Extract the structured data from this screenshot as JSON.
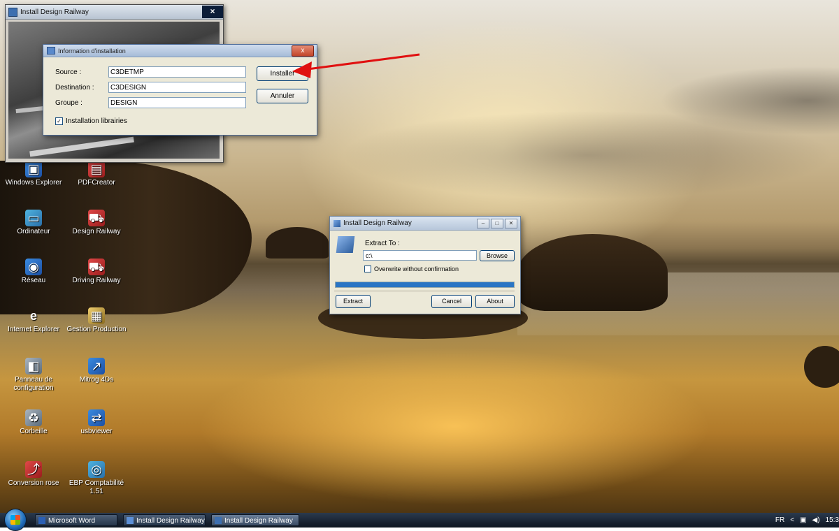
{
  "desktop": {
    "icons": [
      {
        "label": "Windows Explorer",
        "icon": "explorer-icon"
      },
      {
        "label": "PDFCreator",
        "icon": "pdfcreator-icon"
      },
      {
        "label": "Ordinateur",
        "icon": "computer-icon"
      },
      {
        "label": "Design Railway",
        "icon": "design-railway-icon"
      },
      {
        "label": "Réseau",
        "icon": "network-icon"
      },
      {
        "label": "Driving Railway",
        "icon": "driving-railway-icon"
      },
      {
        "label": "Internet Explorer",
        "icon": "internet-explorer-icon"
      },
      {
        "label": "Gestion Production",
        "icon": "gestion-production-icon"
      },
      {
        "label": "Panneau de configuration",
        "icon": "control-panel-icon"
      },
      {
        "label": "Mitrog 4Ds",
        "icon": "mitrog-icon"
      },
      {
        "label": "Corbeille",
        "icon": "recycle-bin-icon"
      },
      {
        "label": "usbviewer",
        "icon": "usbviewer-icon"
      },
      {
        "label": "Conversion rose",
        "icon": "conversion-icon"
      },
      {
        "label": "EBP Comptabilité 1.51",
        "icon": "ebp-icon"
      }
    ]
  },
  "back_window": {
    "title": "Install Design Railway",
    "close": "×"
  },
  "info_dialog": {
    "title": "Information d'installation",
    "close": "x",
    "source_label": "Source :",
    "source_value": "C3DETMP",
    "destination_label": "Destination :",
    "destination_value": "C3DESIGN",
    "group_label": "Groupe :",
    "group_value": "DESIGN",
    "install_button": "Installer",
    "cancel_button": "Annuler",
    "checkbox_label": "Installation librairies",
    "checkbox_checked": true,
    "checkbox_mark": "✓"
  },
  "extract_dialog": {
    "title": "Install Design Railway",
    "extract_label": "Extract To :",
    "path_value": "c:\\",
    "browse_button": "Browse",
    "overwrite_label": "Overwrite without confirmation",
    "progress": 1.0,
    "extract_button": "Extract",
    "cancel_button": "Cancel",
    "about_button": "About"
  },
  "taskbar": {
    "tasks": [
      {
        "label": "Microsoft Word"
      },
      {
        "label": "Install Design Railway"
      },
      {
        "label": "Install Design Railway"
      }
    ],
    "lang": "FR",
    "chevron": "<",
    "clock": "15:3"
  },
  "colors": {
    "annotation_arrow": "#e01010",
    "progress_fill": "#2a75c4"
  }
}
